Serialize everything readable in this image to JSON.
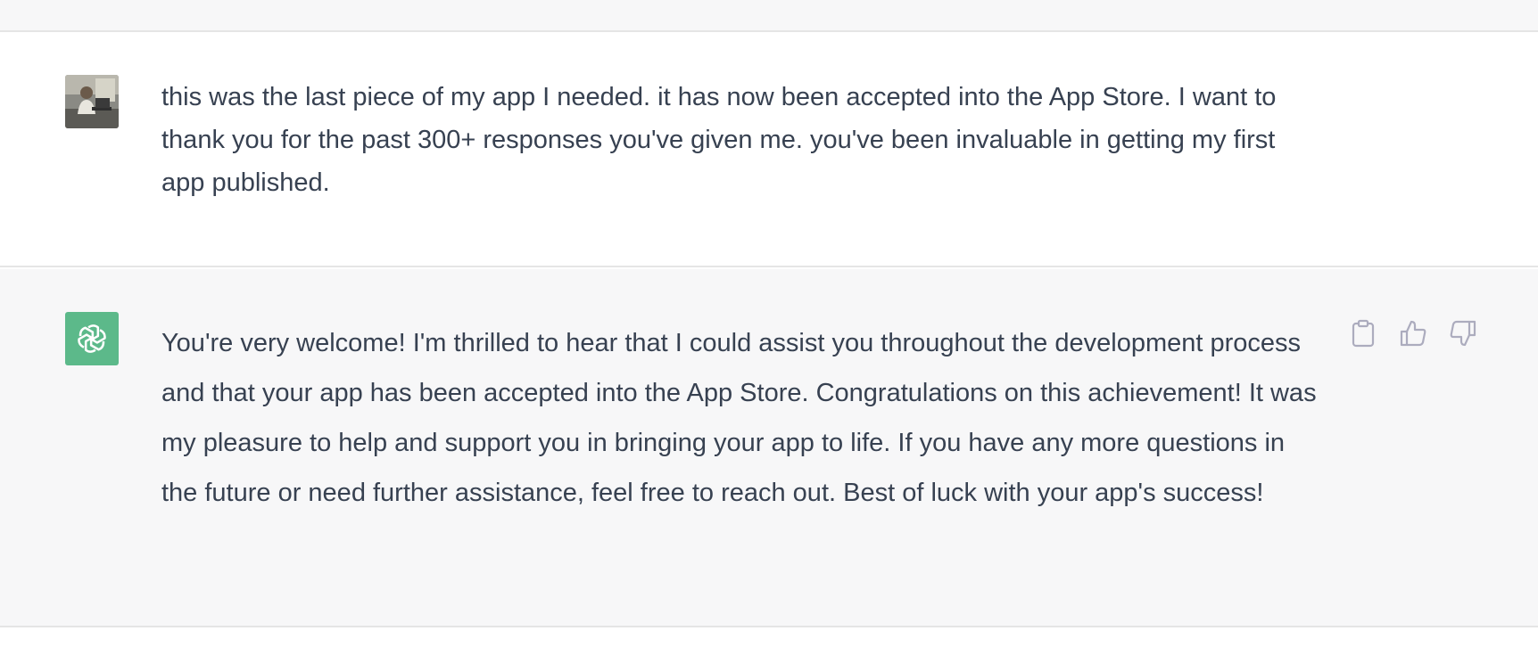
{
  "conversation": {
    "messages": [
      {
        "role": "user",
        "avatar_icon": "user-photo-avatar",
        "text": "this was the last piece of my app I needed. it has now been accepted into the App Store. I want to thank you for the past 300+ responses you've given me. you've been invaluable in getting my first app published."
      },
      {
        "role": "assistant",
        "avatar_icon": "openai-logo-icon",
        "avatar_color": "#5cb98a",
        "text": "You're very welcome! I'm thrilled to hear that I could assist you throughout the development process and that your app has been accepted into the App Store. Congratulations on this achievement! It was my pleasure to help and support you in bringing your app to life. If you have any more questions in the future or need further assistance, feel free to reach out. Best of luck with your app's success!",
        "actions": [
          {
            "icon": "clipboard-icon"
          },
          {
            "icon": "thumbs-up-icon"
          },
          {
            "icon": "thumbs-down-icon"
          }
        ]
      }
    ]
  },
  "colors": {
    "assistant_bg": "#f7f7f8",
    "user_bg": "#ffffff",
    "text": "#374151",
    "icon": "#acacbe"
  }
}
